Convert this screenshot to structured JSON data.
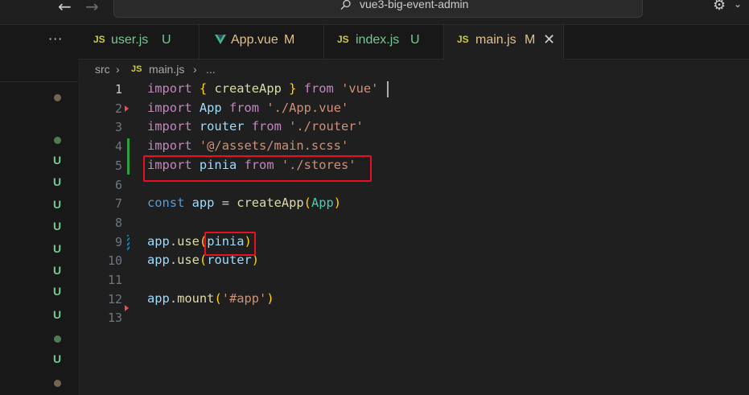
{
  "titlebar": {
    "search_text": "vue3-big-event-admin"
  },
  "sidebar": {
    "more_label": "···",
    "marks": [
      {
        "type": "dot",
        "color": "#73654f"
      },
      {
        "type": "dot",
        "color": "#4f7a52"
      },
      {
        "type": "text",
        "text": "U",
        "color": "#73c991"
      },
      {
        "type": "text",
        "text": "U",
        "color": "#73c991"
      },
      {
        "type": "text",
        "text": "U",
        "color": "#73c991"
      },
      {
        "type": "text",
        "text": "U",
        "color": "#73c991"
      },
      {
        "type": "text",
        "text": "U",
        "color": "#73c991"
      },
      {
        "type": "text",
        "text": "U",
        "color": "#73c991"
      },
      {
        "type": "text",
        "text": "U",
        "color": "#73c991"
      },
      {
        "type": "text",
        "text": "U",
        "color": "#73c991"
      },
      {
        "type": "dot",
        "color": "#4f7a52"
      },
      {
        "type": "text",
        "text": "U",
        "color": "#73c991"
      },
      {
        "type": "dot",
        "color": "#73654f"
      }
    ]
  },
  "tabs": [
    {
      "icon": "JS",
      "name": "user.js",
      "status": "U",
      "name_color": "#73c991",
      "status_color": "#73c991",
      "active": false
    },
    {
      "icon": "vue",
      "name": "App.vue",
      "status": "M",
      "name_color": "#e2c08d",
      "status_color": "#e2c08d",
      "active": false
    },
    {
      "icon": "JS",
      "name": "index.js",
      "status": "U",
      "name_color": "#73c991",
      "status_color": "#73c991",
      "active": false
    },
    {
      "icon": "JS",
      "name": "main.js",
      "status": "M",
      "name_color": "#e2c08d",
      "status_color": "#e2c08d",
      "active": true,
      "close": "✕"
    }
  ],
  "breadcrumb": {
    "folder": "src",
    "sep": "›",
    "file_icon": "JS",
    "file": "main.js",
    "sep2": "›",
    "symbol": "..."
  },
  "editor": {
    "lines": [
      {
        "n": "1",
        "tokens": [
          [
            "kw",
            "import"
          ],
          [
            "pu",
            " "
          ],
          [
            "br",
            "{"
          ],
          [
            "pu",
            " "
          ],
          [
            "fn",
            "createApp"
          ],
          [
            "pu",
            " "
          ],
          [
            "br",
            "}"
          ],
          [
            "pu",
            " "
          ],
          [
            "kw",
            "from"
          ],
          [
            "pu",
            " "
          ],
          [
            "str",
            "'vue'"
          ]
        ]
      },
      {
        "n": "2",
        "tokens": [
          [
            "kw",
            "import"
          ],
          [
            "pu",
            " "
          ],
          [
            "var",
            "App"
          ],
          [
            "pu",
            " "
          ],
          [
            "kw",
            "from"
          ],
          [
            "pu",
            " "
          ],
          [
            "str",
            "'./App.vue'"
          ]
        ]
      },
      {
        "n": "3",
        "tokens": [
          [
            "kw",
            "import"
          ],
          [
            "pu",
            " "
          ],
          [
            "var",
            "router"
          ],
          [
            "pu",
            " "
          ],
          [
            "kw",
            "from"
          ],
          [
            "pu",
            " "
          ],
          [
            "str",
            "'./router'"
          ]
        ]
      },
      {
        "n": "4",
        "tokens": [
          [
            "kw",
            "import"
          ],
          [
            "pu",
            " "
          ],
          [
            "str",
            "'@/assets/main.scss'"
          ]
        ]
      },
      {
        "n": "5",
        "tokens": [
          [
            "kw",
            "import"
          ],
          [
            "pu",
            " "
          ],
          [
            "var",
            "pinia"
          ],
          [
            "pu",
            " "
          ],
          [
            "kw",
            "from"
          ],
          [
            "pu",
            " "
          ],
          [
            "str",
            "'./stores'"
          ]
        ]
      },
      {
        "n": "6",
        "tokens": []
      },
      {
        "n": "7",
        "tokens": [
          [
            "kb",
            "const"
          ],
          [
            "pu",
            " "
          ],
          [
            "var",
            "app"
          ],
          [
            "pu",
            " = "
          ],
          [
            "fn",
            "createApp"
          ],
          [
            "br",
            "("
          ],
          [
            "cls",
            "App"
          ],
          [
            "br",
            ")"
          ]
        ]
      },
      {
        "n": "8",
        "tokens": []
      },
      {
        "n": "9",
        "tokens": [
          [
            "var",
            "app"
          ],
          [
            "pu",
            "."
          ],
          [
            "fn",
            "use"
          ],
          [
            "br",
            "("
          ],
          [
            "var",
            "pinia"
          ],
          [
            "br",
            ")"
          ]
        ]
      },
      {
        "n": "10",
        "tokens": [
          [
            "var",
            "app"
          ],
          [
            "pu",
            "."
          ],
          [
            "fn",
            "use"
          ],
          [
            "br",
            "("
          ],
          [
            "var",
            "router"
          ],
          [
            "br",
            ")"
          ]
        ]
      },
      {
        "n": "11",
        "tokens": []
      },
      {
        "n": "12",
        "tokens": [
          [
            "var",
            "app"
          ],
          [
            "pu",
            "."
          ],
          [
            "fn",
            "mount"
          ],
          [
            "br",
            "("
          ],
          [
            "str",
            "'#app'"
          ],
          [
            "br",
            ")"
          ]
        ]
      },
      {
        "n": "13",
        "tokens": []
      }
    ]
  },
  "colors": {
    "added": "#2ea043",
    "modified": "#1b81a8",
    "deleted": "#f14c4c",
    "highlight_box": "#e81123"
  }
}
